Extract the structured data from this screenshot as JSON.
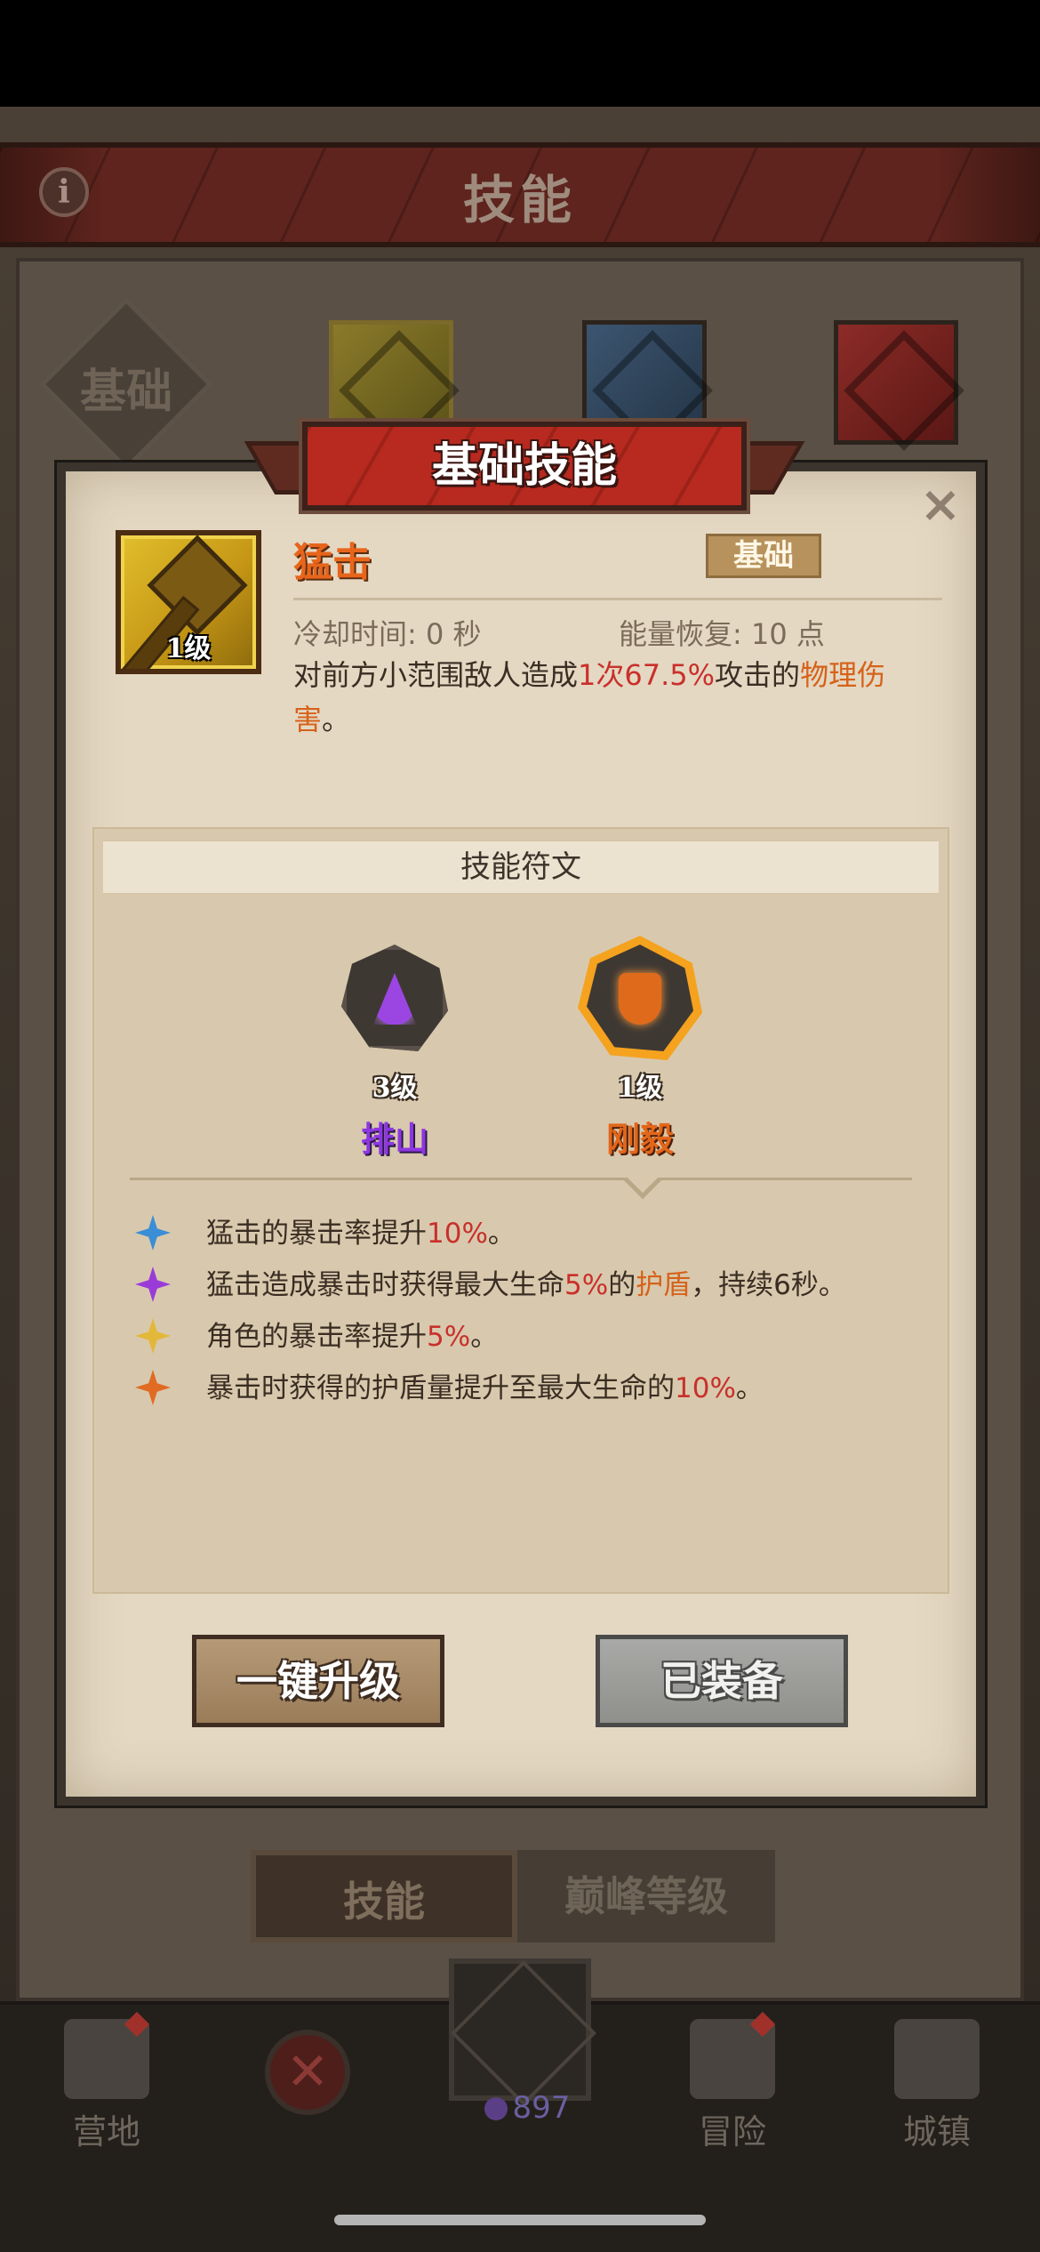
{
  "background": {
    "screen_title": "技能",
    "info_icon": "info-icon",
    "category_label": "基础",
    "bottom_tabs": [
      "技能",
      "巅峰等级"
    ],
    "nav": {
      "camp": "营地",
      "adventure": "冒险",
      "town": "城镇",
      "currency_value": "897"
    }
  },
  "modal": {
    "title": "基础技能",
    "close_glyph": "×",
    "skill": {
      "name": "猛击",
      "level": "1级",
      "type": "基础",
      "cooldown": "冷却时间: 0 秒",
      "energy": "能量恢复: 10 点",
      "desc_parts": [
        "对前方小范围敌人造成",
        "1次",
        "67.5%",
        "攻击的",
        "物理伤害",
        "。"
      ]
    },
    "runes": {
      "header": "技能符文",
      "items": [
        {
          "level": "3级",
          "name": "排山"
        },
        {
          "level": "1级",
          "name": "刚毅"
        }
      ]
    },
    "effects": [
      {
        "parts": [
          "猛击的暴击率提升",
          "10%",
          "。"
        ]
      },
      {
        "parts": [
          "猛击造成暴击时获得最大生命",
          "5%",
          "的",
          "护盾",
          "，持续6秒。"
        ]
      },
      {
        "parts": [
          "角色的暴击率提升",
          "5%",
          "。"
        ]
      },
      {
        "parts": [
          "暴击时获得的护盾量提升至最大生命的",
          "10%",
          "。"
        ]
      }
    ],
    "buttons": {
      "upgrade": "一键升级",
      "equipped": "已装备"
    }
  },
  "colors": {
    "highlight_red": "#c9302a",
    "highlight_orange": "#d6621a",
    "skill_name": "#e8651c",
    "rune_purple": "#8d37e0",
    "rune_orange": "#e3661b"
  }
}
